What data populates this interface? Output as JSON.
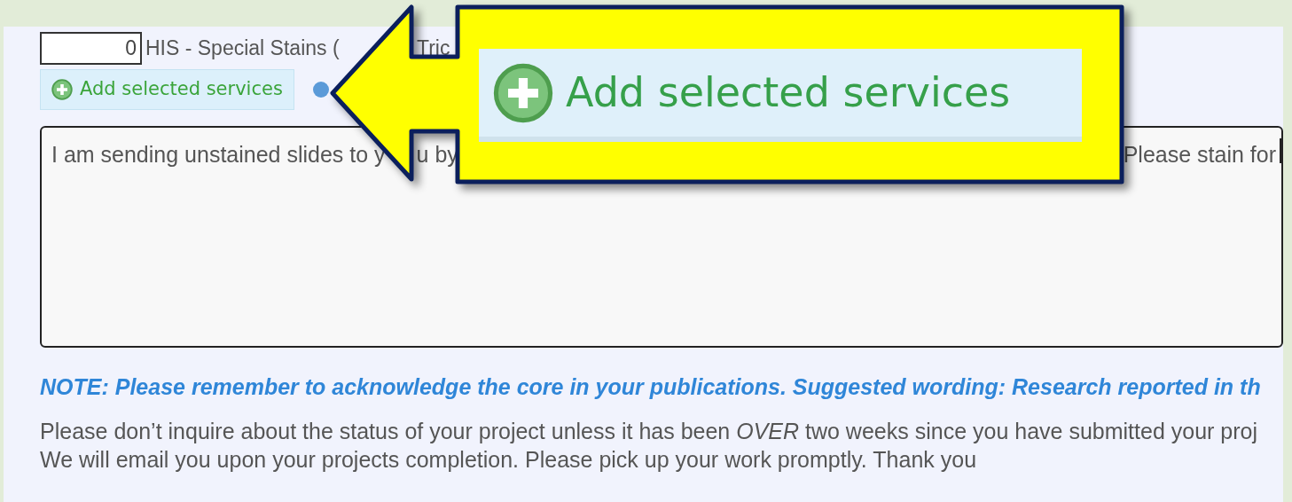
{
  "service_row": {
    "quantity": "0",
    "label_before": "HIS - Special Stains (",
    "label_after": "Tric"
  },
  "add_button": {
    "label": "Add selected services"
  },
  "comments": {
    "parts": [
      "I am sending unstained slides to y",
      "u by",
      "Please stain for"
    ]
  },
  "note": "NOTE: Please remember to acknowledge the core in your publications. Suggested wording: Research reported in th",
  "instructions": [
    "Please don’t inquire about the status of your project unless it has been *OVER* two weeks since you have submitted your proj",
    "We will email you upon your projects completion. Please pick up your work promptly. Thank you"
  ],
  "callout": {
    "label": "Add selected services"
  }
}
